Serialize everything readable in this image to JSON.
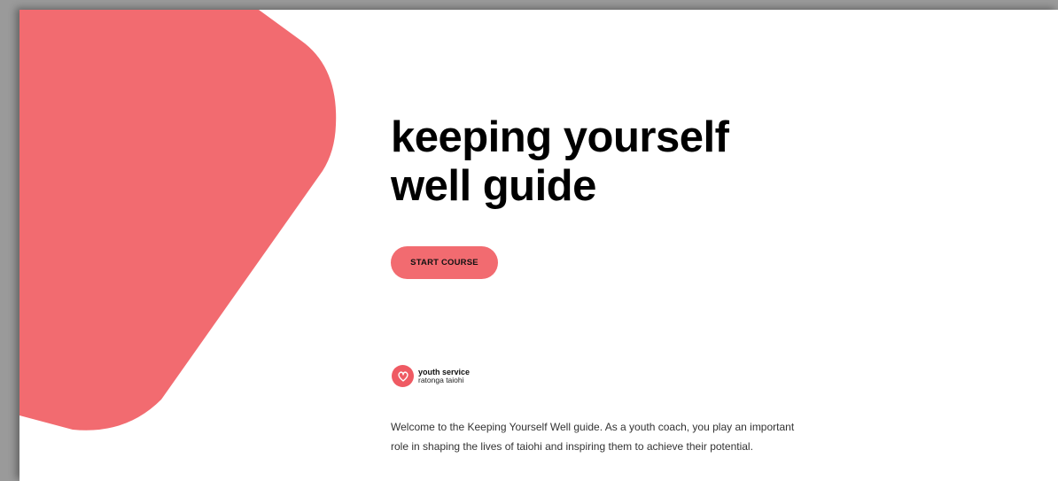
{
  "hero": {
    "title_line1": "keeping yourself",
    "title_line2": "well guide",
    "start_label": "START COURSE"
  },
  "logo": {
    "line1": "youth service",
    "line2": "ratonga taiohi",
    "icon": "heart-icon"
  },
  "intro": {
    "text": "Welcome to the Keeping Yourself Well guide. As a youth coach, you play an important role in shaping the lives of taiohi and inspiring them to achieve their potential."
  },
  "colors": {
    "accent": "#f26b70",
    "logo_mark": "#ef5a63",
    "text": "#000000",
    "body_text": "#333333",
    "background": "#ffffff"
  }
}
